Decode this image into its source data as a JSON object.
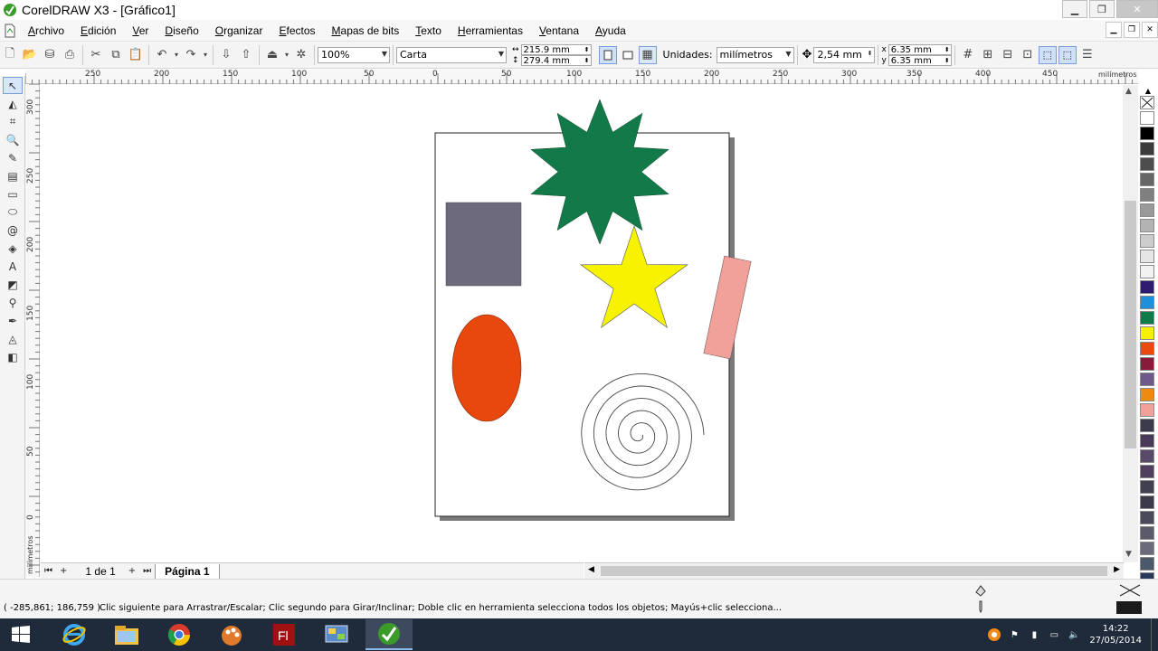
{
  "window": {
    "title": "CorelDRAW X3 - [Gráfico1]",
    "controls": {
      "minimize": "▁",
      "restore": "❐",
      "close": "✕"
    }
  },
  "menu": [
    {
      "label": "Archivo",
      "mnemonic": "A",
      "rest": "rchivo"
    },
    {
      "label": "Edición",
      "mnemonic": "E",
      "rest": "dición"
    },
    {
      "label": "Ver",
      "mnemonic": "V",
      "rest": "er"
    },
    {
      "label": "Diseño",
      "mnemonic": "D",
      "rest": "iseño"
    },
    {
      "label": "Organizar",
      "mnemonic": "O",
      "rest": "rganizar"
    },
    {
      "label": "Efectos",
      "mnemonic": "E",
      "rest": "fectos"
    },
    {
      "label": "Mapas de bits",
      "mnemonic": "M",
      "rest": "apas de bits"
    },
    {
      "label": "Texto",
      "mnemonic": "T",
      "rest": "exto"
    },
    {
      "label": "Herramientas",
      "mnemonic": "H",
      "rest": "erramientas"
    },
    {
      "label": "Ventana",
      "mnemonic": "V",
      "rest": "entana"
    },
    {
      "label": "Ayuda",
      "mnemonic": "A",
      "rest": "yuda"
    }
  ],
  "toolbar": {
    "zoom": "100%",
    "paper": "Carta",
    "width": "215.9 mm",
    "height": "279.4 mm",
    "units_label": "Unidades:",
    "units": "milímetros",
    "nudge": "2,54 mm",
    "dup_x": "6.35 mm",
    "dup_y": "6.35 mm"
  },
  "ruler": {
    "h_labels": [
      "250",
      "200",
      "150",
      "100",
      "50",
      "0",
      "50",
      "100",
      "150",
      "200",
      "250",
      "300",
      "350",
      "400",
      "450"
    ],
    "h_unit": "milímetros",
    "v_labels": [
      "300",
      "250",
      "200",
      "150",
      "100",
      "50",
      "0"
    ],
    "v_unit": "milímetros"
  },
  "tools": [
    "pick-tool",
    "shape-tool",
    "crop-tool",
    "zoom-tool",
    "freehand-tool",
    "smart-fill-tool",
    "rectangle-tool",
    "ellipse-tool",
    "spiral-tool",
    "basic-shapes-tool",
    "text-tool",
    "interactive-blend-tool",
    "eyedropper-tool",
    "outline-tool",
    "fill-tool",
    "interactive-fill-tool"
  ],
  "palette": [
    "#ffffff",
    "#000000",
    "#3b3b3b",
    "#4d4d4d",
    "#666666",
    "#808080",
    "#999999",
    "#b3b3b3",
    "#cccccc",
    "#e6e6e6",
    "#f2f2f2",
    "#2e1a6e",
    "#1e8fd8",
    "#0f7a4a",
    "#f4f000",
    "#ea4a10",
    "#8a1a3a",
    "#6e5a8a",
    "#ee8a10",
    "#f2a09a",
    "#3a3a4a",
    "#4a3a5a",
    "#5a4a6a",
    "#504060",
    "#404050",
    "#3a3a48",
    "#4a4a5a",
    "#5a5a6a",
    "#6a6a7a",
    "#4a5a6a",
    "#2a3a5a",
    "#707080"
  ],
  "pagebar": {
    "page_count": "1 de 1",
    "page_tab": "Página 1"
  },
  "status": {
    "coords": "( -285,861; 186,759 )",
    "hint": "Clic siguiente para Arrastrar/Escalar; Clic segundo para Girar/Inclinar; Doble clic en herramienta selecciona todos los objetos; Mayús+clic selecciona..."
  },
  "colors": {
    "star_green": "#127a48",
    "rect_gray": "#6e6a7e",
    "star_yellow": "#f7f300",
    "rect_pink": "#f2a09a",
    "ellipse_orange": "#e8470d",
    "spiral_stroke": "#444444",
    "page_shadow": "#7a7a7a"
  },
  "taskbar": {
    "apps": [
      "windows-start",
      "internet-explorer",
      "file-explorer",
      "chrome",
      "paint-app",
      "flash-app",
      "control-panel",
      "coreldraw"
    ],
    "time": "14:22",
    "date": "27/05/2014"
  }
}
